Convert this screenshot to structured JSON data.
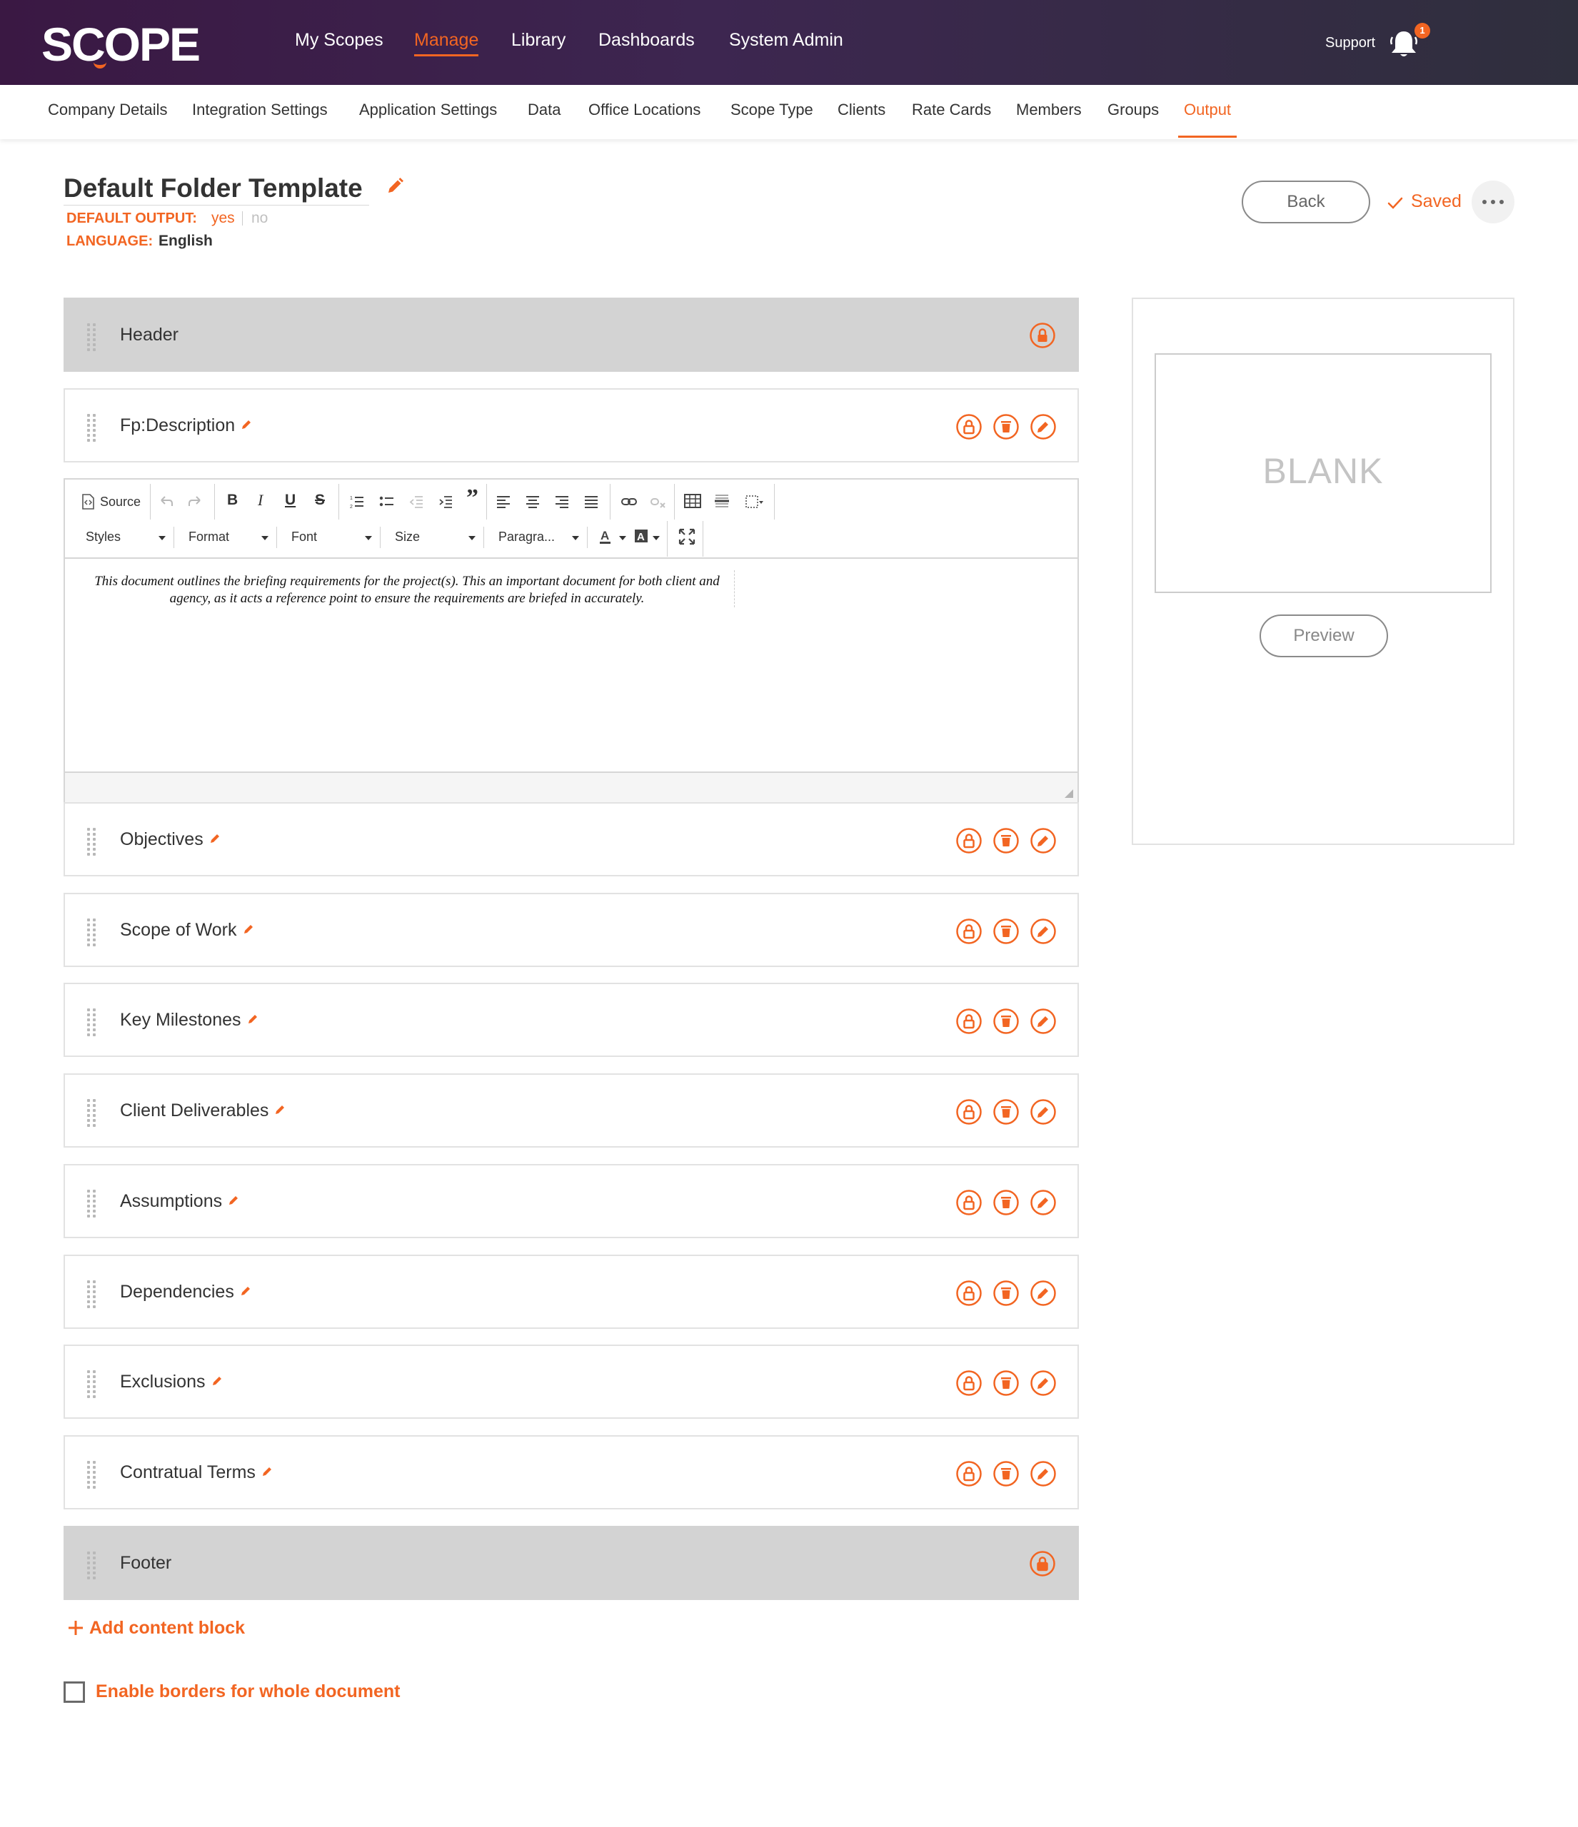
{
  "app": {
    "logo": "SCOPE",
    "brand_color": "#f26522",
    "nav": [
      {
        "label": "My Scopes",
        "active": false
      },
      {
        "label": "Manage",
        "active": true
      },
      {
        "label": "Library",
        "active": false
      },
      {
        "label": "Dashboards",
        "active": false
      },
      {
        "label": "System Admin",
        "active": false
      }
    ],
    "support_label": "Support",
    "notification_count": "1"
  },
  "subnav": [
    {
      "label": "Company Details",
      "active": false
    },
    {
      "label": "Integration Settings",
      "active": false
    },
    {
      "label": "Application Settings",
      "active": false
    },
    {
      "label": "Data",
      "active": false
    },
    {
      "label": "Office Locations",
      "active": false
    },
    {
      "label": "Scope Type",
      "active": false
    },
    {
      "label": "Clients",
      "active": false
    },
    {
      "label": "Rate Cards",
      "active": false
    },
    {
      "label": "Members",
      "active": false
    },
    {
      "label": "Groups",
      "active": false
    },
    {
      "label": "Output",
      "active": true
    }
  ],
  "header": {
    "title": "Default Folder Template",
    "default_output_label": "DEFAULT OUTPUT:",
    "default_output_yes": "yes",
    "default_output_no": "no",
    "default_output_selected": "yes",
    "language_label": "LANGUAGE:",
    "language_value": "English",
    "back_label": "Back",
    "saved_label": "Saved"
  },
  "blocks": [
    {
      "label": "Header",
      "locked": true,
      "editable": false
    },
    {
      "label": "Fp:Description",
      "locked": false,
      "editable": true,
      "expanded": true
    },
    {
      "label": "Objectives",
      "locked": false,
      "editable": true
    },
    {
      "label": "Scope of Work",
      "locked": false,
      "editable": true
    },
    {
      "label": "Key Milestones",
      "locked": false,
      "editable": true
    },
    {
      "label": "Client Deliverables",
      "locked": false,
      "editable": true
    },
    {
      "label": "Assumptions",
      "locked": false,
      "editable": true
    },
    {
      "label": "Dependencies",
      "locked": false,
      "editable": true
    },
    {
      "label": "Exclusions",
      "locked": false,
      "editable": true
    },
    {
      "label": "Contratual Terms",
      "locked": false,
      "editable": true
    },
    {
      "label": "Footer",
      "locked": true,
      "editable": false
    }
  ],
  "editor": {
    "toolbar": {
      "source_label": "Source",
      "styles_label": "Styles",
      "format_label": "Format",
      "font_label": "Font",
      "size_label": "Size",
      "paragraph_label": "Paragra..."
    },
    "content": "This document outlines the briefing requirements for the project(s). This an important document for both client and agency, as it acts a reference point to ensure the requirements are briefed in accurately."
  },
  "preview": {
    "placeholder": "BLANK",
    "button_label": "Preview"
  },
  "actions": {
    "add_block_label": "Add content block",
    "borders_label": "Enable borders for whole document",
    "borders_checked": false
  }
}
